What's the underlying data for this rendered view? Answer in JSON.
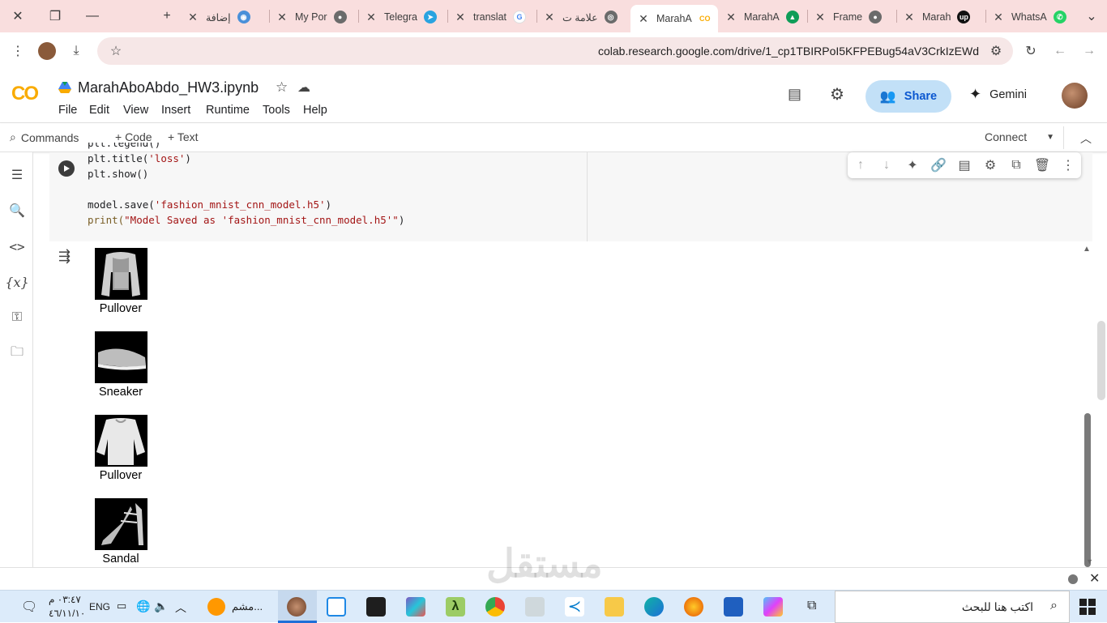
{
  "browser": {
    "tabs": [
      {
        "title": "إضافة",
        "favicon": "circle-blue-icon",
        "active": false
      },
      {
        "title": "My Por",
        "favicon": "globe-icon",
        "active": false
      },
      {
        "title": "Telegra",
        "favicon": "telegram-icon",
        "active": false
      },
      {
        "title": "translat",
        "favicon": "google-icon",
        "active": false
      },
      {
        "title": "علامة ت",
        "favicon": "chrome-icon",
        "active": false
      },
      {
        "title": "MarahA",
        "favicon": "colab-icon",
        "active": true
      },
      {
        "title": "MarahA",
        "favicon": "drive-icon",
        "active": false
      },
      {
        "title": "Frame",
        "favicon": "globe-icon",
        "active": false
      },
      {
        "title": "Marah",
        "favicon": "upwork-icon",
        "active": false
      },
      {
        "title": "WhatsA",
        "favicon": "whatsapp-icon",
        "active": false
      }
    ],
    "url": "colab.research.google.com/drive/1_cp1TBIRPoI5KFPEBug54aV3CrkIzEWd"
  },
  "colab": {
    "logo": "CO",
    "notebook_title": "MarahAboAbdo_HW3.ipynb",
    "menu": [
      "File",
      "Edit",
      "View",
      "Insert",
      "Runtime",
      "Tools",
      "Help"
    ],
    "share_label": "Share",
    "gemini_label": "Gemini"
  },
  "toolbar": {
    "commands_label": "Commands",
    "code_label": "+ Code",
    "text_label": "+ Text",
    "connect_label": "Connect"
  },
  "cell": {
    "code_lines": [
      {
        "plain": "plt.legend()",
        "str": ""
      },
      {
        "plain": "plt.title(",
        "str": "'loss'",
        "tail": ")"
      },
      {
        "plain": "plt.show()",
        "str": ""
      },
      {
        "plain": "",
        "str": ""
      },
      {
        "plain": "model.save(",
        "str": "'fashion_mnist_cnn_model.h5'",
        "tail": ")"
      },
      {
        "plain": "print(",
        "str": "\"Model Saved as 'fashion_mnist_cnn_model.h5'\"",
        "tail": ")"
      }
    ]
  },
  "output": {
    "items": [
      {
        "label": "Pullover",
        "kind": "pullover-dark"
      },
      {
        "label": "Sneaker",
        "kind": "sneaker"
      },
      {
        "label": "Pullover",
        "kind": "pullover-light"
      },
      {
        "label": "Sandal",
        "kind": "sandal"
      }
    ]
  },
  "watermark": "مستقل",
  "taskbar": {
    "search_placeholder": "اكتب هنا للبحث",
    "time": "٠٣:٤٧ م",
    "date": "٤٦/١١/١٠",
    "language": "ENG",
    "app_label": "مشم..."
  }
}
